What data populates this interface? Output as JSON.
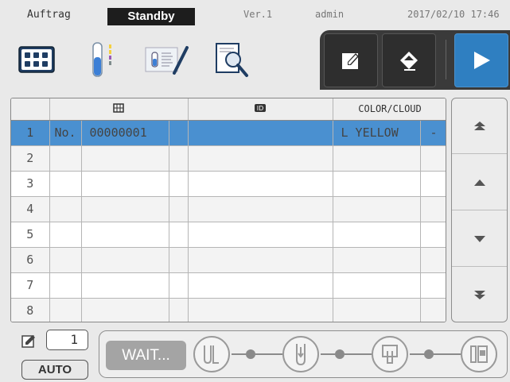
{
  "header": {
    "mode": "Auftrag",
    "status": "Standby",
    "version": "Ver.1",
    "user": "admin",
    "datetime": "2017/02/10 17:46"
  },
  "toolbar": {
    "icons": [
      "rack-icon",
      "test-tube-icon",
      "strip-chart-icon",
      "report-search-icon"
    ],
    "actions": [
      "edit-icon",
      "erase-icon",
      "start-icon"
    ]
  },
  "table": {
    "headers": {
      "rack": "rack-icon",
      "id": "id-icon",
      "color": "COLOR/CLOUD"
    },
    "rows": [
      {
        "n": "1",
        "prefix": "No.",
        "value": "00000001",
        "color": "L YELLOW",
        "cloud": "-"
      },
      {
        "n": "2",
        "prefix": "",
        "value": "",
        "color": "",
        "cloud": ""
      },
      {
        "n": "3",
        "prefix": "",
        "value": "",
        "color": "",
        "cloud": ""
      },
      {
        "n": "4",
        "prefix": "",
        "value": "",
        "color": "",
        "cloud": ""
      },
      {
        "n": "5",
        "prefix": "",
        "value": "",
        "color": "",
        "cloud": ""
      },
      {
        "n": "6",
        "prefix": "",
        "value": "",
        "color": "",
        "cloud": ""
      },
      {
        "n": "7",
        "prefix": "",
        "value": "",
        "color": "",
        "cloud": ""
      },
      {
        "n": "8",
        "prefix": "",
        "value": "",
        "color": "",
        "cloud": ""
      }
    ],
    "selected_row": 1
  },
  "scroll": [
    "page-up-icon",
    "up-icon",
    "down-icon",
    "page-down-icon"
  ],
  "bottom": {
    "count": "1",
    "auto_label": "AUTO",
    "wait_label": "WAIT...",
    "stages": [
      "tube-in-icon",
      "tube-icon",
      "strip-icon",
      "rack-out-icon"
    ]
  },
  "colors": {
    "selected_row": "#4a90d0",
    "start_button": "#2f7fc1",
    "status_bg": "#1d1d1d"
  }
}
